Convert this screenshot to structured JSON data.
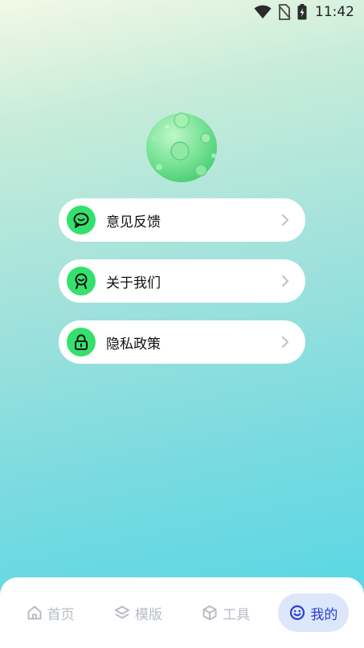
{
  "status_bar": {
    "time": "11:42",
    "icons": [
      "wifi-icon",
      "no-sim-icon",
      "battery-charging-icon"
    ]
  },
  "menu": [
    {
      "label": "意见反馈",
      "icon": "chat-bubble-icon"
    },
    {
      "label": "关于我们",
      "icon": "badge-icon"
    },
    {
      "label": "隐私政策",
      "icon": "lock-icon"
    }
  ],
  "bottom_nav": {
    "tabs": [
      {
        "label": "首页",
        "icon": "home-icon",
        "active": false
      },
      {
        "label": "模版",
        "icon": "layers-icon",
        "active": false
      },
      {
        "label": "工具",
        "icon": "box-icon",
        "active": false
      },
      {
        "label": "我的",
        "icon": "smiley-icon",
        "active": true
      }
    ]
  },
  "colors": {
    "accent_green": "#34e06e",
    "active_tab_bg": "#dde7fb",
    "active_tab_text": "#2a3fd8",
    "inactive_tab_text": "#b7bcc4"
  }
}
